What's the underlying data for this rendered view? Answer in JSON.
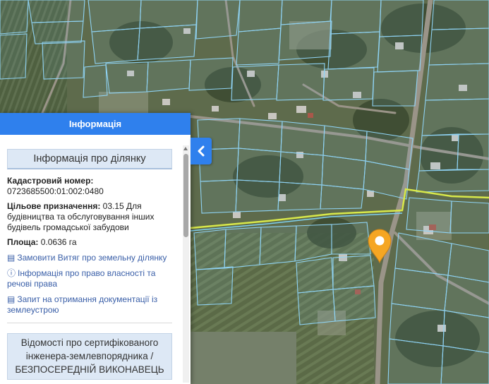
{
  "panel": {
    "title": "Інформація",
    "section_title": "Інформація про ділянку",
    "cadastral_label": "Кадастровий номер:",
    "cadastral_value": "0723685500:01:002:0480",
    "purpose_label": "Цільове призначення:",
    "purpose_value": " 03.15 Для будівництва та обслуговування інших будівель громадської забудови",
    "area_label": "Площа:",
    "area_value": " 0.0636 га",
    "links": [
      {
        "label": "Замовити Витяг про земельну ділянку",
        "icon": "document-list-icon"
      },
      {
        "label": "Інформація про право власності та речові права",
        "icon": "info-circle-icon"
      },
      {
        "label": "Запит на отримання документації із землеустрою",
        "icon": "document-list-icon"
      }
    ],
    "certified_engineer": "Відомості про сертифікованого інженера-землевпорядника / БЕЗПОСЕРЕДНІЙ ВИКОНАВЕЦЬ"
  },
  "colors": {
    "accent": "#2f80ed",
    "parcel_outline": "#8fd3f4",
    "boundary_line": "#d8e84a",
    "marker": "#f5a623",
    "link": "#3a5fa8"
  },
  "icons": {
    "collapse": "chevron-left-icon",
    "marker": "map-pin-icon"
  }
}
